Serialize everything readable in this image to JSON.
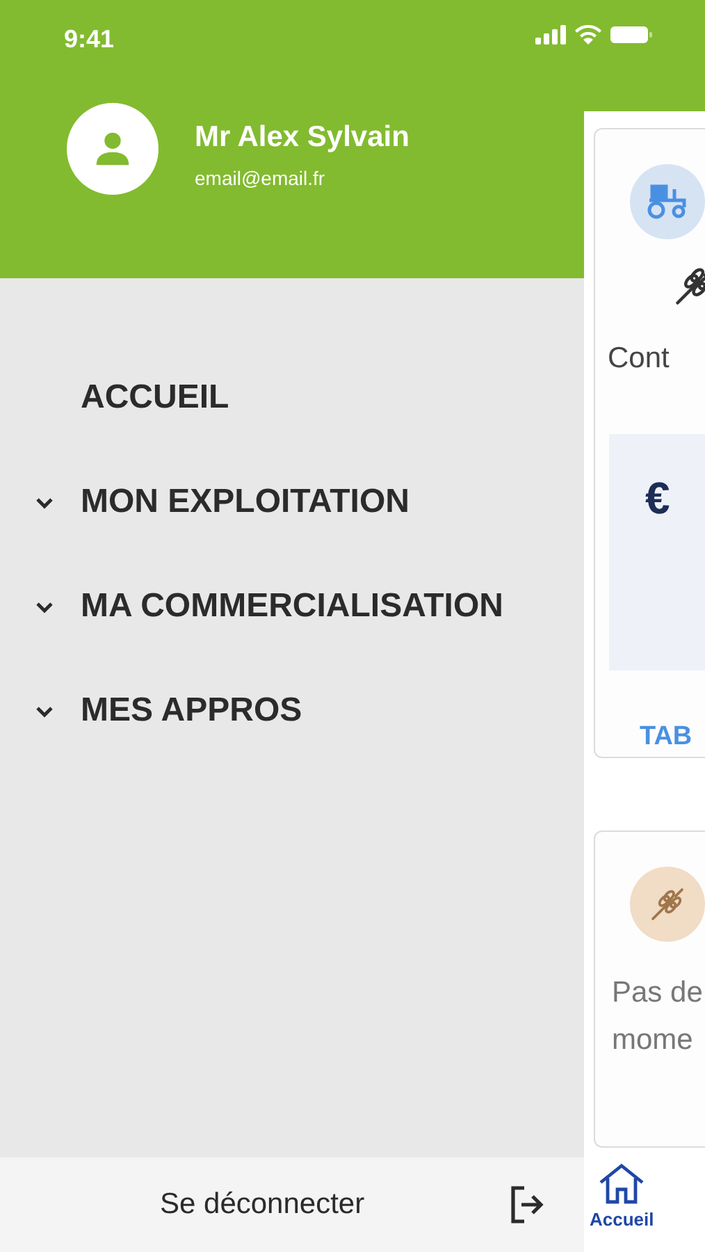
{
  "status_bar": {
    "time": "9:41"
  },
  "drawer": {
    "user": {
      "name": "Mr Alex Sylvain",
      "email": "email@email.fr"
    },
    "items": [
      {
        "label": "ACCUEIL",
        "kind": "link"
      },
      {
        "label": "MON EXPLOITATION",
        "kind": "group"
      },
      {
        "label": "MA COMMERCIALISATION",
        "kind": "group"
      },
      {
        "label": "MES APPROS",
        "kind": "group"
      }
    ],
    "logout": "Se déconnecter"
  },
  "background_page": {
    "card_1": {
      "text": "Cont",
      "currency": "€",
      "link": "TAB"
    },
    "card_2": {
      "lines": [
        "Pas de",
        "mome"
      ]
    },
    "bottom_nav": [
      {
        "label": "Accueil",
        "selected": true
      }
    ]
  }
}
